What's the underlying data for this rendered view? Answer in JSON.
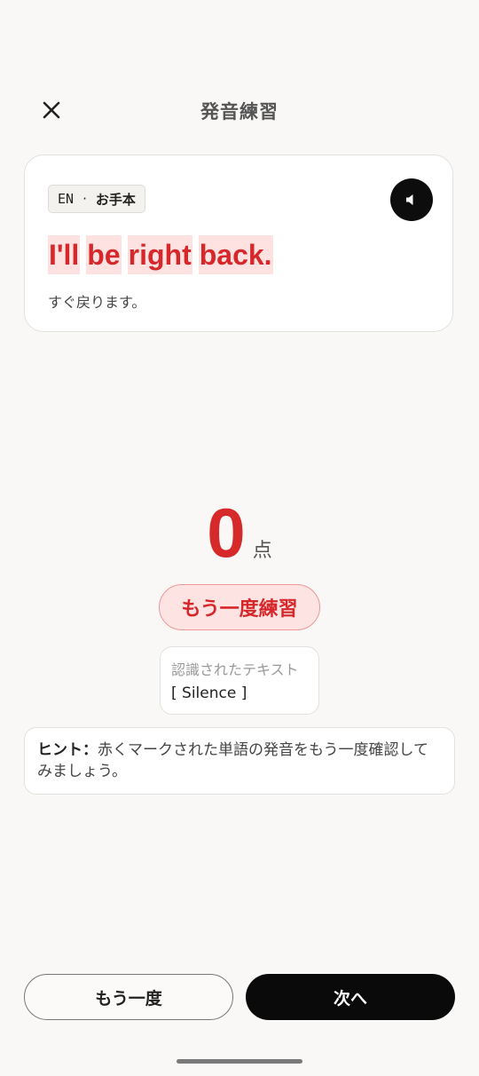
{
  "header": {
    "title": "発音練習",
    "close_icon": "close-icon"
  },
  "card": {
    "lang_code": "EN",
    "separator": "·",
    "model_label": "お手本",
    "speaker_icon": "speaker-icon",
    "sentence_words": [
      "I'll",
      "be",
      "right",
      "back."
    ],
    "translation": "すぐ戻ります。"
  },
  "score": {
    "value": "0",
    "unit": "点"
  },
  "retry_label": "もう一度練習",
  "recognized": {
    "label": "認識されたテキスト",
    "text": "[ Silence ]"
  },
  "hint": {
    "prefix": "ヒント：",
    "text": "赤くマークされた単語の発音をもう一度確認してみましょう。"
  },
  "buttons": {
    "again_label": "もう一度",
    "next_label": "次へ"
  },
  "colors": {
    "error_red": "#d6282b",
    "highlight": "#fde2e1",
    "dark": "#0a0a0a"
  }
}
